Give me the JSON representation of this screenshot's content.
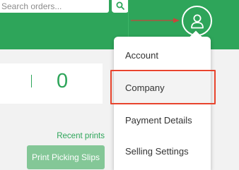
{
  "header": {
    "search": {
      "placeholder": "Search orders..."
    },
    "search_button": {
      "icon": "search-icon"
    },
    "account_button": {
      "icon": "user-icon"
    }
  },
  "stats": {
    "value": "0"
  },
  "recent": {
    "link_label": "Recent prints",
    "print_button_label": "Print Picking Slips"
  },
  "menu": {
    "items": [
      {
        "label": "Account"
      },
      {
        "label": "Company",
        "highlighted": true
      },
      {
        "label": "Payment Details"
      },
      {
        "label": "Selling Settings"
      }
    ]
  },
  "colors": {
    "brand_green": "#2ea55a",
    "highlight_red": "#e8442d",
    "button_green_light": "#84c797"
  }
}
